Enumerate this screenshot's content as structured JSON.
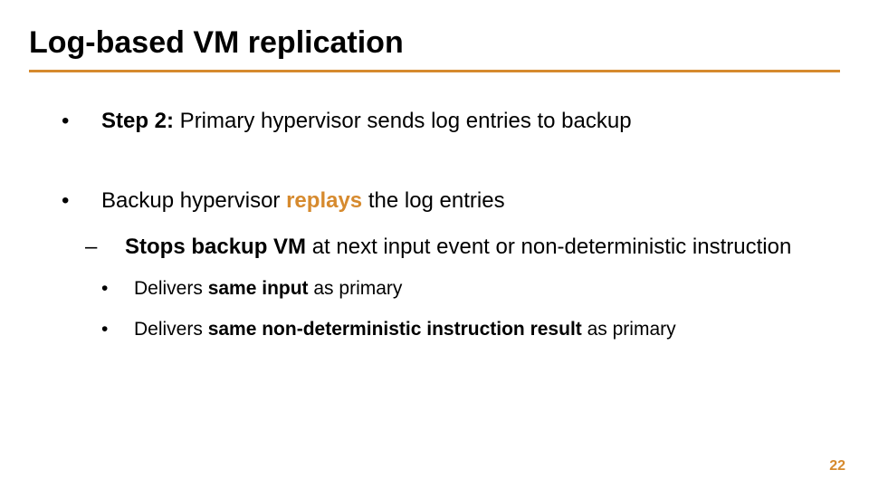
{
  "title": "Log-based VM replication",
  "bullets": {
    "b1a_prefix": "Step 2:",
    "b1a_rest": " Primary hypervisor sends log entries to backup",
    "b1b_pre": "Backup hypervisor ",
    "b1b_em": "replays",
    "b1b_post": " the log entries",
    "b2a_pre": "Stops backup VM",
    "b2a_post": " at next input event or non-deterministic instruction",
    "b3a_pre": "Delivers ",
    "b3a_em": "same input",
    "b3a_post": " as primary",
    "b3b_pre": "Delivers ",
    "b3b_em": "same non-deterministic instruction result",
    "b3b_post": " as primary"
  },
  "page_number": "22",
  "colors": {
    "accent": "#d68a2e"
  }
}
